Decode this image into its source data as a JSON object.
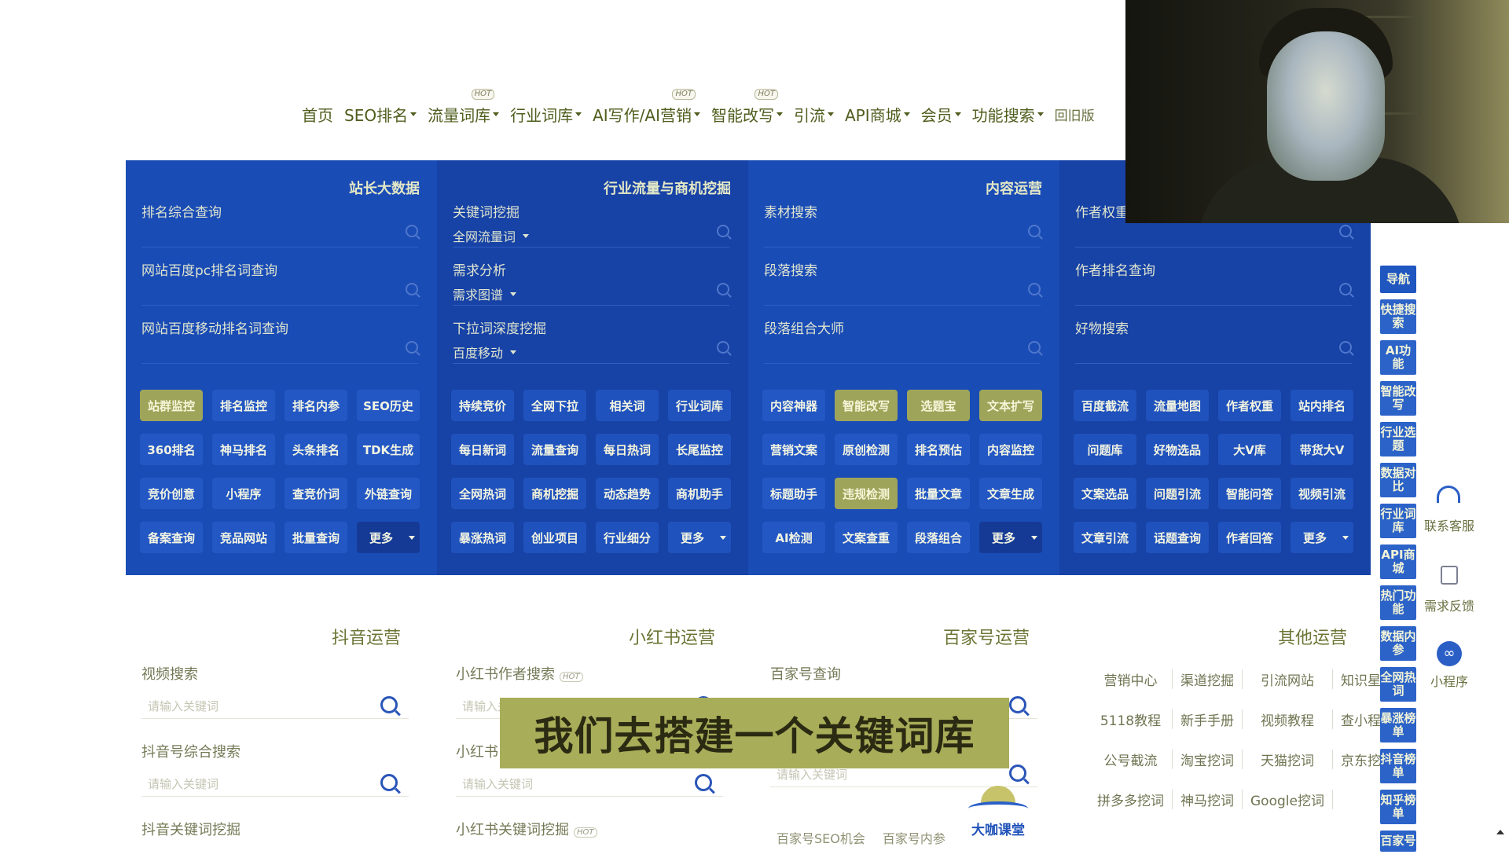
{
  "nav": {
    "items": [
      {
        "label": "首页",
        "caret": false,
        "hot": false
      },
      {
        "label": "SEO排名",
        "caret": true,
        "hot": false
      },
      {
        "label": "流量词库",
        "caret": true,
        "hot": true
      },
      {
        "label": "行业词库",
        "caret": true,
        "hot": false
      },
      {
        "label": "AI写作/AI营销",
        "caret": true,
        "hot": true
      },
      {
        "label": "智能改写",
        "caret": true,
        "hot": true
      },
      {
        "label": "引流",
        "caret": true,
        "hot": false
      },
      {
        "label": "API商城",
        "caret": true,
        "hot": false
      },
      {
        "label": "会员",
        "caret": true,
        "hot": false
      },
      {
        "label": "功能搜索",
        "caret": true,
        "hot": false
      }
    ],
    "hot_label": "HOT",
    "old_version": "回旧版"
  },
  "panel": {
    "columns": [
      {
        "title": "站长大数据",
        "queries": [
          {
            "label": "排名综合查询",
            "sub": ""
          },
          {
            "label": "网站百度pc排名词查询",
            "sub": ""
          },
          {
            "label": "网站百度移动排名词查询",
            "sub": ""
          }
        ],
        "buttons": [
          {
            "label": "站群监控",
            "hl": true
          },
          {
            "label": "排名监控",
            "hl": false
          },
          {
            "label": "排名内参",
            "hl": false
          },
          {
            "label": "SEO历史",
            "hl": false
          },
          {
            "label": "360排名",
            "hl": false
          },
          {
            "label": "神马排名",
            "hl": false
          },
          {
            "label": "头条排名",
            "hl": false
          },
          {
            "label": "TDK生成",
            "hl": false
          },
          {
            "label": "竞价创意",
            "hl": false
          },
          {
            "label": "小程序",
            "hl": false
          },
          {
            "label": "查竞价词",
            "hl": false
          },
          {
            "label": "外链查询",
            "hl": false
          },
          {
            "label": "备案查询",
            "hl": false
          },
          {
            "label": "竞品网站",
            "hl": false
          },
          {
            "label": "批量查询",
            "hl": false
          },
          {
            "label": "更多",
            "more": true
          }
        ]
      },
      {
        "title": "行业流量与商机挖掘",
        "queries": [
          {
            "label": "关键词挖掘",
            "sub": "全网流量词"
          },
          {
            "label": "需求分析",
            "sub": "需求图谱"
          },
          {
            "label": "下拉词深度挖掘",
            "sub": "百度移动"
          }
        ],
        "buttons": [
          {
            "label": "持续竞价",
            "hl": false
          },
          {
            "label": "全网下拉",
            "hl": false
          },
          {
            "label": "相关词",
            "hl": false
          },
          {
            "label": "行业词库",
            "hl": false
          },
          {
            "label": "每日新词",
            "hl": false
          },
          {
            "label": "流量查询",
            "hl": false
          },
          {
            "label": "每日热词",
            "hl": true
          },
          {
            "label": "长尾监控",
            "hl": false
          },
          {
            "label": "全网热词",
            "hl": false
          },
          {
            "label": "商机挖掘",
            "hl": true
          },
          {
            "label": "动态趋势",
            "hl": false
          },
          {
            "label": "商机助手",
            "hl": false
          },
          {
            "label": "暴涨热词",
            "hl": false
          },
          {
            "label": "创业项目",
            "hl": false
          },
          {
            "label": "行业细分",
            "hl": false
          },
          {
            "label": "更多",
            "more": true
          }
        ]
      },
      {
        "title": "内容运营",
        "queries": [
          {
            "label": "素材搜索",
            "sub": ""
          },
          {
            "label": "段落搜索",
            "sub": ""
          },
          {
            "label": "段落组合大师",
            "sub": ""
          }
        ],
        "buttons": [
          {
            "label": "内容神器",
            "hl": false
          },
          {
            "label": "智能改写",
            "hl": true
          },
          {
            "label": "选题宝",
            "hl": true
          },
          {
            "label": "文本扩写",
            "hl": true
          },
          {
            "label": "营销文案",
            "hl": false
          },
          {
            "label": "原创检测",
            "hl": false
          },
          {
            "label": "排名预估",
            "hl": false
          },
          {
            "label": "内容监控",
            "hl": false
          },
          {
            "label": "标题助手",
            "hl": false
          },
          {
            "label": "违规检测",
            "hl": true
          },
          {
            "label": "批量文章",
            "hl": false
          },
          {
            "label": "文章生成",
            "hl": false
          },
          {
            "label": "AI检测",
            "hl": false
          },
          {
            "label": "文案查重",
            "hl": false
          },
          {
            "label": "段落组合",
            "hl": false
          },
          {
            "label": "更多",
            "more": true
          }
        ]
      },
      {
        "title": "",
        "queries": [
          {
            "label": "作者权重",
            "sub": ""
          },
          {
            "label": "作者排名查询",
            "sub": ""
          },
          {
            "label": "好物搜索",
            "sub": ""
          }
        ],
        "buttons": [
          {
            "label": "百度截流",
            "hl": false
          },
          {
            "label": "流量地图",
            "hl": false
          },
          {
            "label": "作者权重",
            "hl": false
          },
          {
            "label": "站内排名",
            "hl": false
          },
          {
            "label": "问题库",
            "hl": false
          },
          {
            "label": "好物选品",
            "hl": false
          },
          {
            "label": "大V库",
            "hl": false
          },
          {
            "label": "带货大V",
            "hl": false
          },
          {
            "label": "文案选品",
            "hl": false
          },
          {
            "label": "问题引流",
            "hl": true
          },
          {
            "label": "智能问答",
            "hl": false
          },
          {
            "label": "视频引流",
            "hl": false
          },
          {
            "label": "文章引流",
            "hl": false
          },
          {
            "label": "话题查询",
            "hl": false
          },
          {
            "label": "作者回答",
            "hl": false
          },
          {
            "label": "更多",
            "more": true
          }
        ]
      }
    ]
  },
  "lower": {
    "titles": [
      "抖音运营",
      "小红书运营",
      "百家号运营",
      "其他运营"
    ],
    "placeholder": "请输入关键词",
    "douyin": [
      "视频搜索",
      "抖音号综合搜索",
      "抖音关键词挖掘"
    ],
    "xhs": [
      "小红书作者搜索",
      "小红书",
      "小红书关键词挖掘"
    ],
    "bjh": [
      "百家号查询",
      "百家号SEO机会",
      "百家号内参"
    ],
    "other_links": [
      "营销中心",
      "渠道挖掘",
      "引流网站",
      "知识星球",
      "5118教程",
      "新手手册",
      "视频教程",
      "查小程序",
      "公号截流",
      "淘宝挖词",
      "天猫挖词",
      "京东挖词",
      "拼多多挖词",
      "神马挖词",
      "Google挖词"
    ]
  },
  "subtitle": "我们去搭建一个关键词库",
  "logo_text": "大咖课堂",
  "sidebar": {
    "items": [
      "导航",
      "快捷搜索",
      "AI功能",
      "智能改写",
      "行业选题",
      "数据对比",
      "行业词库",
      "API商城",
      "热门功能",
      "数据内参",
      "全网热词",
      "暴涨榜单",
      "抖音榜单",
      "知乎榜单",
      "百家号"
    ]
  },
  "tools": {
    "service": "联系客服",
    "feedback": "需求反馈",
    "miniapp": "小程序"
  },
  "colors": {
    "panel_blue": "#1848b2",
    "highlight": "#9ea55a",
    "subtitle_bg": "#a8ad59"
  }
}
